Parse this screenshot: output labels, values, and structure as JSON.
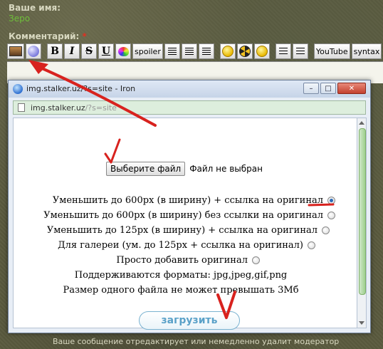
{
  "form": {
    "name_label": "Ваше имя:",
    "name_value": "Зеро",
    "comment_label": "Комментарий:",
    "required_mark": "*"
  },
  "toolbar": {
    "buttons": [
      "B",
      "I",
      "S",
      "U",
      "spoiler",
      "YouTube",
      "syntax"
    ],
    "icons": [
      "image-icon",
      "link-icon",
      "bold",
      "italic",
      "strike",
      "underline",
      "palette-icon",
      "spoiler",
      "align-left-icon",
      "align-center-icon",
      "align-right-icon",
      "smile-icon",
      "radiation-icon",
      "wink-icon",
      "ordered-list-icon",
      "unordered-list-icon",
      "youtube",
      "syntax"
    ]
  },
  "popup": {
    "title": "img.stalker.uz/?s=site - Iron",
    "url_host": "img.stalker.uz",
    "url_query": "/?s=site",
    "file_button": "Выберите файл",
    "file_status": "Файл не выбран",
    "options": [
      {
        "label": "Уменьшить до 600px (в ширину) + ссылка на оригинал",
        "selected": true
      },
      {
        "label": "Уменьшить до 600px (в ширину) без ссылки на оригинал",
        "selected": false
      },
      {
        "label": "Уменьшить до 125px (в ширину) + ссылка на оригинал",
        "selected": false
      },
      {
        "label": "Для галереи (ум. до 125px + ссылка на оригинал)",
        "selected": false
      },
      {
        "label": "Просто добавить оригинал",
        "selected": false
      }
    ],
    "formats_text": "Поддерживаются форматы: jpg,jpeg,gif,png",
    "size_text": "Размер одного файла не может превышать 3Мб",
    "upload_button": "загрузить"
  },
  "page_bottom_text": "Ваше сообщение отредактирует или немедленно удалит модератор",
  "colors": {
    "annotation_red": "#d8221e",
    "name_green": "#6fbf3a",
    "upload_blue": "#5aa1c8",
    "scroll_green": "#9fd08e"
  }
}
